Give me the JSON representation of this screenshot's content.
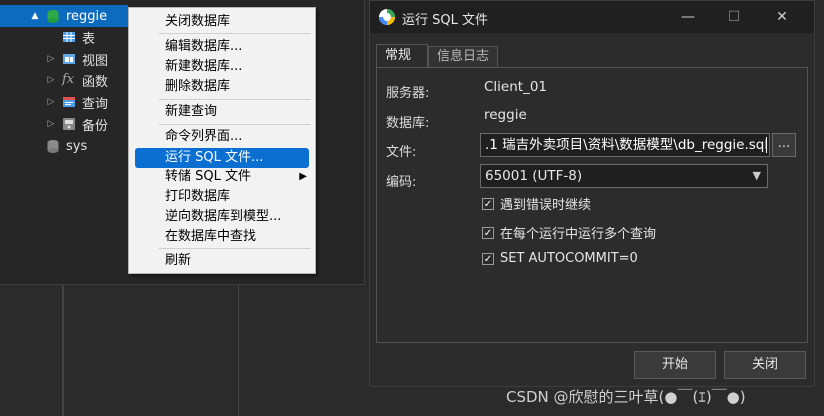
{
  "tree": {
    "items": [
      {
        "label": "reggie",
        "icon": "database-green-icon",
        "expand": "▲",
        "selected": true
      },
      {
        "label": "表",
        "icon": "table-icon",
        "expand": ""
      },
      {
        "label": "视图",
        "icon": "view-icon",
        "expand": "▷"
      },
      {
        "label": "函数",
        "icon": "function-icon",
        "expand": "▷"
      },
      {
        "label": "查询",
        "icon": "query-icon",
        "expand": "▷"
      },
      {
        "label": "备份",
        "icon": "backup-icon",
        "expand": "▷"
      },
      {
        "label": "sys",
        "icon": "database-gray-icon",
        "expand": ""
      }
    ]
  },
  "context_menu": {
    "items": [
      {
        "label": "关闭数据库"
      },
      {
        "label": "编辑数据库..."
      },
      {
        "label": "新建数据库..."
      },
      {
        "label": "删除数据库"
      },
      {
        "label": "新建查询"
      },
      {
        "label": "命令列界面..."
      },
      {
        "label": "运行 SQL 文件...",
        "highlighted": true
      },
      {
        "label": "转储 SQL 文件",
        "submenu": true
      },
      {
        "label": "打印数据库"
      },
      {
        "label": "逆向数据库到模型..."
      },
      {
        "label": "在数据库中查找"
      },
      {
        "label": "刷新"
      }
    ]
  },
  "dialog": {
    "title": "运行 SQL 文件",
    "minimize": "—",
    "maximize": "☐",
    "close": "✕",
    "tabs": [
      {
        "label": "常规",
        "active": true
      },
      {
        "label": "信息日志",
        "active": false
      }
    ],
    "server_label": "服务器:",
    "server_value": "Client_01",
    "database_label": "数据库:",
    "database_value": "reggie",
    "file_label": "文件:",
    "file_value": ".1 瑞吉外卖项目\\资料\\数据模型\\db_reggie.sql",
    "browse_label": "...",
    "encoding_label": "编码:",
    "encoding_value": "65001 (UTF-8)",
    "options": [
      {
        "label": "遇到错误时继续",
        "checked": true
      },
      {
        "label": "在每个运行中运行多个查询",
        "checked": true
      },
      {
        "label": "SET AUTOCOMMIT=0",
        "checked": true
      }
    ],
    "start_button": "开始",
    "close_button": "关闭"
  },
  "watermark": "CSDN @欣慰的三叶草(●￣(ｴ)￣●)",
  "colors": {
    "selection": "#0a6fd1",
    "dialog_bg": "#2c2c2c",
    "menu_bg": "#f2f2f2"
  }
}
